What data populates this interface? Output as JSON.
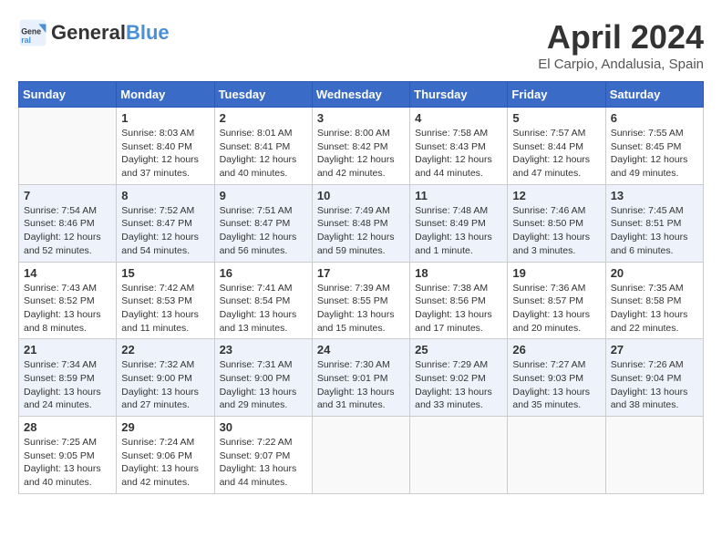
{
  "header": {
    "logo_line1": "General",
    "logo_line2": "Blue",
    "month": "April 2024",
    "location": "El Carpio, Andalusia, Spain"
  },
  "weekdays": [
    "Sunday",
    "Monday",
    "Tuesday",
    "Wednesday",
    "Thursday",
    "Friday",
    "Saturday"
  ],
  "weeks": [
    [
      {
        "day": "",
        "info": ""
      },
      {
        "day": "1",
        "info": "Sunrise: 8:03 AM\nSunset: 8:40 PM\nDaylight: 12 hours\nand 37 minutes."
      },
      {
        "day": "2",
        "info": "Sunrise: 8:01 AM\nSunset: 8:41 PM\nDaylight: 12 hours\nand 40 minutes."
      },
      {
        "day": "3",
        "info": "Sunrise: 8:00 AM\nSunset: 8:42 PM\nDaylight: 12 hours\nand 42 minutes."
      },
      {
        "day": "4",
        "info": "Sunrise: 7:58 AM\nSunset: 8:43 PM\nDaylight: 12 hours\nand 44 minutes."
      },
      {
        "day": "5",
        "info": "Sunrise: 7:57 AM\nSunset: 8:44 PM\nDaylight: 12 hours\nand 47 minutes."
      },
      {
        "day": "6",
        "info": "Sunrise: 7:55 AM\nSunset: 8:45 PM\nDaylight: 12 hours\nand 49 minutes."
      }
    ],
    [
      {
        "day": "7",
        "info": "Sunrise: 7:54 AM\nSunset: 8:46 PM\nDaylight: 12 hours\nand 52 minutes."
      },
      {
        "day": "8",
        "info": "Sunrise: 7:52 AM\nSunset: 8:47 PM\nDaylight: 12 hours\nand 54 minutes."
      },
      {
        "day": "9",
        "info": "Sunrise: 7:51 AM\nSunset: 8:47 PM\nDaylight: 12 hours\nand 56 minutes."
      },
      {
        "day": "10",
        "info": "Sunrise: 7:49 AM\nSunset: 8:48 PM\nDaylight: 12 hours\nand 59 minutes."
      },
      {
        "day": "11",
        "info": "Sunrise: 7:48 AM\nSunset: 8:49 PM\nDaylight: 13 hours\nand 1 minute."
      },
      {
        "day": "12",
        "info": "Sunrise: 7:46 AM\nSunset: 8:50 PM\nDaylight: 13 hours\nand 3 minutes."
      },
      {
        "day": "13",
        "info": "Sunrise: 7:45 AM\nSunset: 8:51 PM\nDaylight: 13 hours\nand 6 minutes."
      }
    ],
    [
      {
        "day": "14",
        "info": "Sunrise: 7:43 AM\nSunset: 8:52 PM\nDaylight: 13 hours\nand 8 minutes."
      },
      {
        "day": "15",
        "info": "Sunrise: 7:42 AM\nSunset: 8:53 PM\nDaylight: 13 hours\nand 11 minutes."
      },
      {
        "day": "16",
        "info": "Sunrise: 7:41 AM\nSunset: 8:54 PM\nDaylight: 13 hours\nand 13 minutes."
      },
      {
        "day": "17",
        "info": "Sunrise: 7:39 AM\nSunset: 8:55 PM\nDaylight: 13 hours\nand 15 minutes."
      },
      {
        "day": "18",
        "info": "Sunrise: 7:38 AM\nSunset: 8:56 PM\nDaylight: 13 hours\nand 17 minutes."
      },
      {
        "day": "19",
        "info": "Sunrise: 7:36 AM\nSunset: 8:57 PM\nDaylight: 13 hours\nand 20 minutes."
      },
      {
        "day": "20",
        "info": "Sunrise: 7:35 AM\nSunset: 8:58 PM\nDaylight: 13 hours\nand 22 minutes."
      }
    ],
    [
      {
        "day": "21",
        "info": "Sunrise: 7:34 AM\nSunset: 8:59 PM\nDaylight: 13 hours\nand 24 minutes."
      },
      {
        "day": "22",
        "info": "Sunrise: 7:32 AM\nSunset: 9:00 PM\nDaylight: 13 hours\nand 27 minutes."
      },
      {
        "day": "23",
        "info": "Sunrise: 7:31 AM\nSunset: 9:00 PM\nDaylight: 13 hours\nand 29 minutes."
      },
      {
        "day": "24",
        "info": "Sunrise: 7:30 AM\nSunset: 9:01 PM\nDaylight: 13 hours\nand 31 minutes."
      },
      {
        "day": "25",
        "info": "Sunrise: 7:29 AM\nSunset: 9:02 PM\nDaylight: 13 hours\nand 33 minutes."
      },
      {
        "day": "26",
        "info": "Sunrise: 7:27 AM\nSunset: 9:03 PM\nDaylight: 13 hours\nand 35 minutes."
      },
      {
        "day": "27",
        "info": "Sunrise: 7:26 AM\nSunset: 9:04 PM\nDaylight: 13 hours\nand 38 minutes."
      }
    ],
    [
      {
        "day": "28",
        "info": "Sunrise: 7:25 AM\nSunset: 9:05 PM\nDaylight: 13 hours\nand 40 minutes."
      },
      {
        "day": "29",
        "info": "Sunrise: 7:24 AM\nSunset: 9:06 PM\nDaylight: 13 hours\nand 42 minutes."
      },
      {
        "day": "30",
        "info": "Sunrise: 7:22 AM\nSunset: 9:07 PM\nDaylight: 13 hours\nand 44 minutes."
      },
      {
        "day": "",
        "info": ""
      },
      {
        "day": "",
        "info": ""
      },
      {
        "day": "",
        "info": ""
      },
      {
        "day": "",
        "info": ""
      }
    ]
  ]
}
